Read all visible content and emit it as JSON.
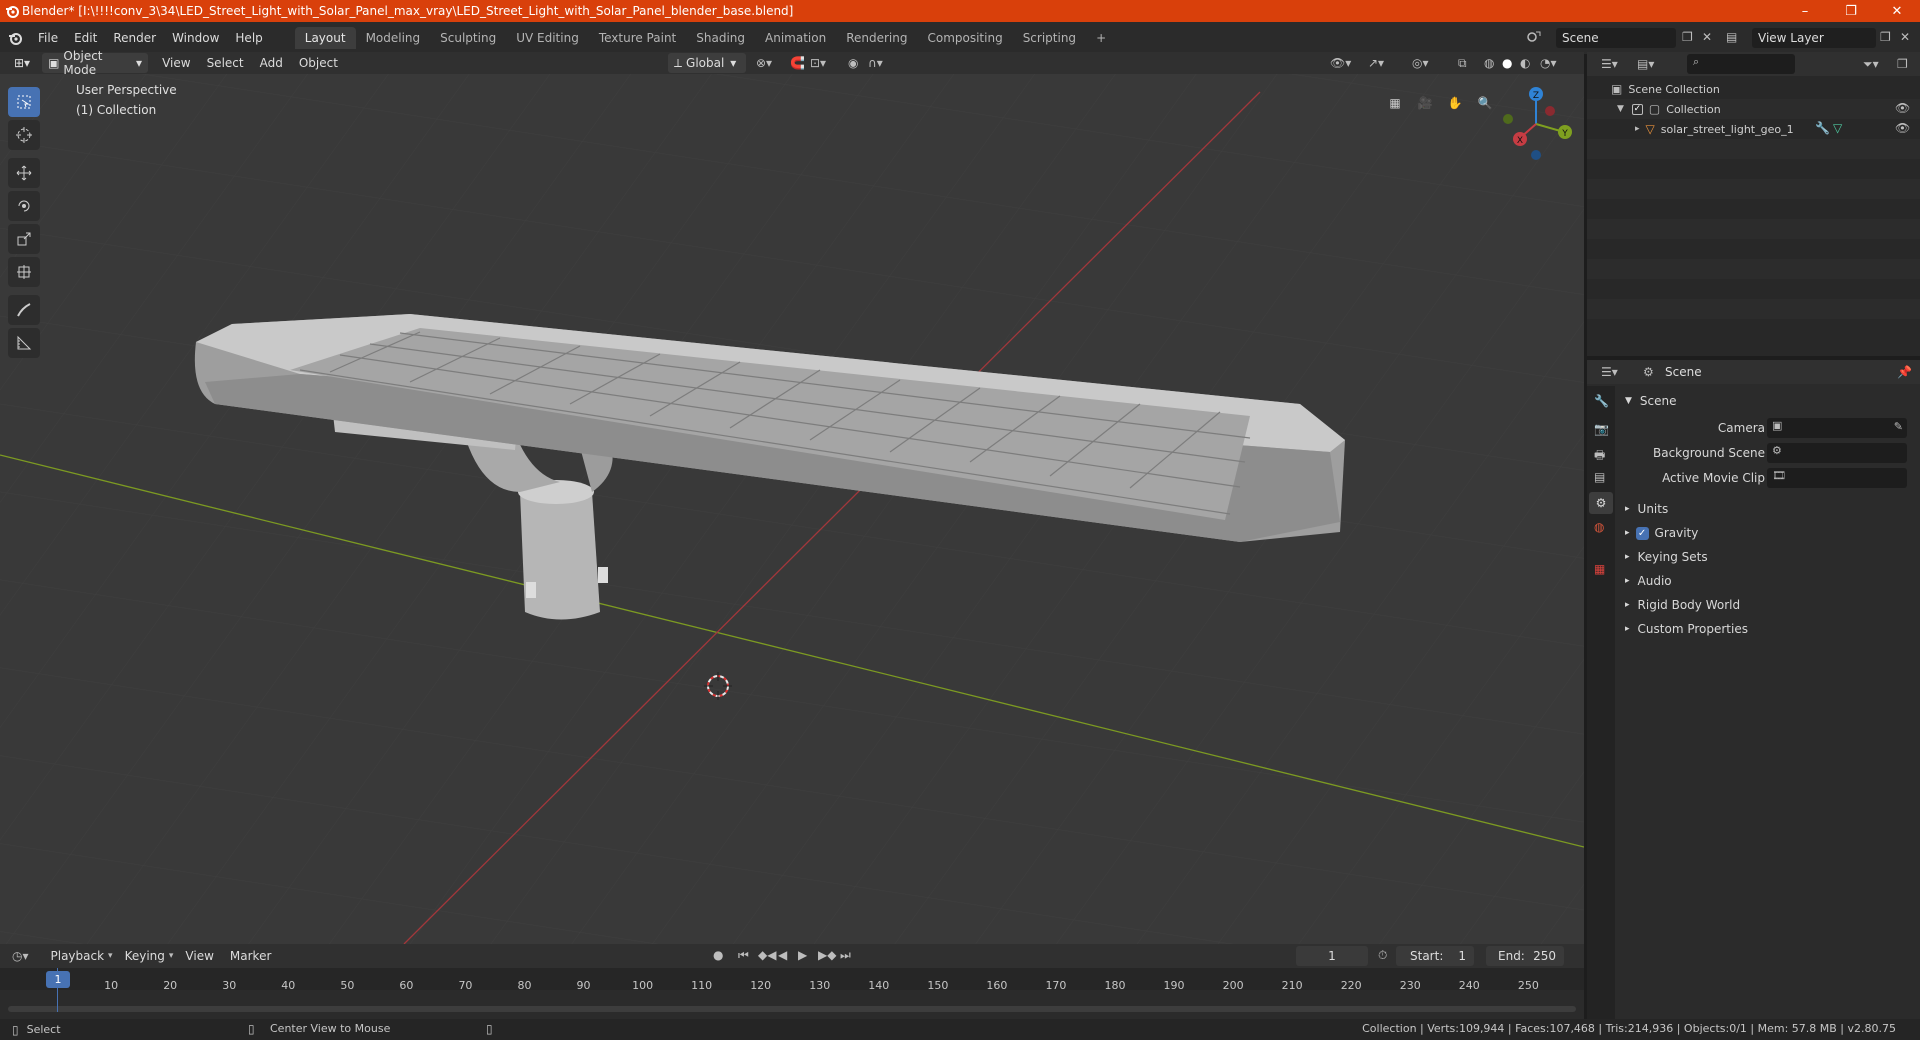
{
  "window": {
    "title": "Blender* [I:\\!!!!conv_3\\34\\LED_Street_Light_with_Solar_Panel_max_vray\\LED_Street_Light_with_Solar_Panel_blender_base.blend]",
    "minimize": "–",
    "restore": "❐",
    "close": "✕"
  },
  "menubar": {
    "items": [
      "File",
      "Edit",
      "Render",
      "Window",
      "Help"
    ],
    "workspaces": [
      "Layout",
      "Modeling",
      "Sculpting",
      "UV Editing",
      "Texture Paint",
      "Shading",
      "Animation",
      "Rendering",
      "Compositing",
      "Scripting"
    ],
    "active_workspace": "Layout",
    "add_tab": "+",
    "scene_name": "Scene",
    "view_layer": "View Layer"
  },
  "viewport_header": {
    "mode": "Object Mode",
    "menus": [
      "View",
      "Select",
      "Add",
      "Object"
    ],
    "transform_orientation": "Global"
  },
  "viewport": {
    "overlay_line1": "User Perspective",
    "overlay_line2": "(1) Collection",
    "gizmo_axes": {
      "x": "X",
      "y": "Y",
      "z": "Z"
    }
  },
  "outliner": {
    "root": "Scene Collection",
    "collection": "Collection",
    "object": "solar_street_light_geo_1"
  },
  "properties": {
    "header": "Scene",
    "section": "Scene",
    "fields": [
      {
        "label": "Camera"
      },
      {
        "label": "Background Scene"
      },
      {
        "label": "Active Movie Clip"
      }
    ],
    "subsections": [
      "Units",
      "Gravity",
      "Keying Sets",
      "Audio",
      "Rigid Body World",
      "Custom Properties"
    ],
    "gravity_checked": true
  },
  "timeline": {
    "menus": [
      "Playback",
      "Keying",
      "View",
      "Marker"
    ],
    "current_frame": "1",
    "start_label": "Start:",
    "start_value": "1",
    "end_label": "End:",
    "end_value": "250",
    "ruler": [
      "1",
      "10",
      "20",
      "30",
      "40",
      "50",
      "60",
      "70",
      "80",
      "90",
      "100",
      "110",
      "120",
      "130",
      "140",
      "150",
      "160",
      "170",
      "180",
      "190",
      "200",
      "210",
      "220",
      "230",
      "240",
      "250"
    ]
  },
  "statusbar": {
    "left_action": "Select",
    "middle_action": "Center View to Mouse",
    "stats": "Collection | Verts:109,944 | Faces:107,468 | Tris:214,936 | Objects:0/1 | Mem: 57.8 MB | v2.80.75"
  },
  "colors": {
    "titlebar": "#d9400b",
    "selected_tool": "#4772b3",
    "x_axis": "#c63c43",
    "y_axis": "#7fa020",
    "z_axis": "#2f83d6"
  }
}
